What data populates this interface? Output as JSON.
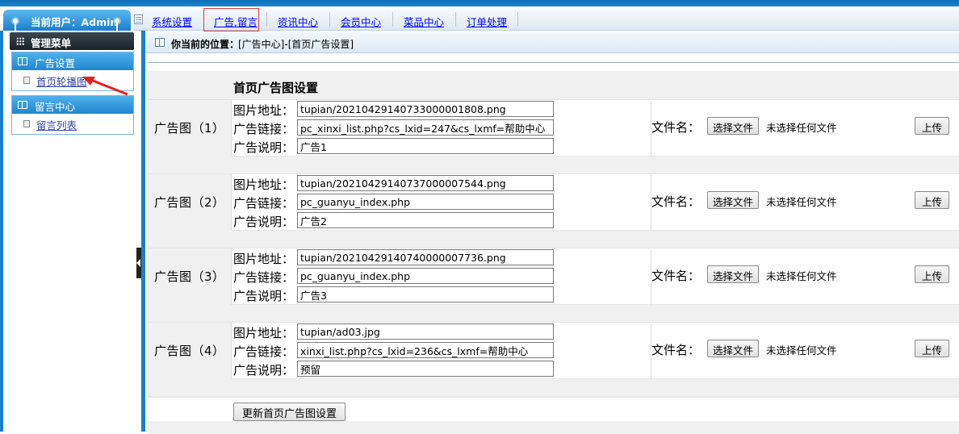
{
  "header": {
    "user_label": "当前用户：Admin",
    "nav": [
      {
        "label": "系统设置"
      },
      {
        "label": "广告,留言"
      },
      {
        "label": "资讯中心"
      },
      {
        "label": "会员中心"
      },
      {
        "label": "菜品中心"
      },
      {
        "label": "订单处理"
      }
    ]
  },
  "sidebar": {
    "title": "管理菜单",
    "groups": [
      {
        "title": "广告设置",
        "items": [
          {
            "label": "首页轮播图"
          }
        ]
      },
      {
        "title": "留言中心",
        "items": [
          {
            "label": "留言列表"
          }
        ]
      }
    ]
  },
  "breadcrumb": {
    "label": "你当前的位置：",
    "path": "[广告中心]-[首页广告设置]"
  },
  "form": {
    "title": "首页广告图设置",
    "field_labels": {
      "image": "图片地址：",
      "link": "广告链接：",
      "desc": "广告说明："
    },
    "file_label": "文件名：",
    "choose_button": "选择文件",
    "no_file_text": "未选择任何文件",
    "upload_button": "上传",
    "ads": [
      {
        "name": "广告图（1）",
        "image": "tupian/20210429140733000001808.png",
        "link": "pc_xinxi_list.php?cs_lxid=247&cs_lxmf=帮助中心",
        "desc": "广告1"
      },
      {
        "name": "广告图（2）",
        "image": "tupian/20210429140737000007544.png",
        "link": "pc_guanyu_index.php",
        "desc": "广告2"
      },
      {
        "name": "广告图（3）",
        "image": "tupian/20210429140740000007736.png",
        "link": "pc_guanyu_index.php",
        "desc": "广告3"
      },
      {
        "name": "广告图（4）",
        "image": "tupian/ad03.jpg",
        "link": "xinxi_list.php?cs_lxid=236&cs_lxmf=帮助中心",
        "desc": "预留"
      }
    ],
    "submit_button": "更新首页广告图设置"
  },
  "colors": {
    "accent": "#1a7fcc",
    "highlight_border": "#ee3333",
    "link": "#0000ff"
  }
}
